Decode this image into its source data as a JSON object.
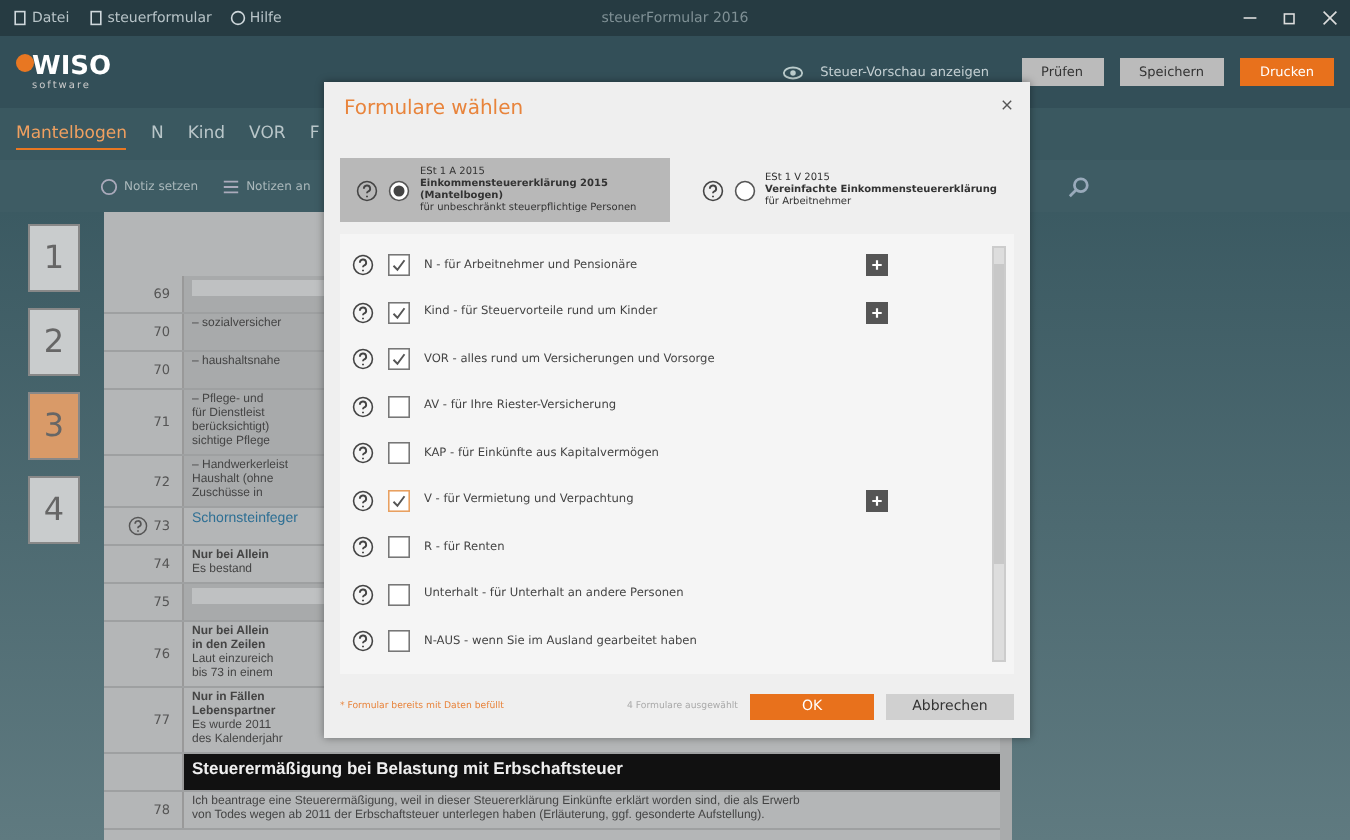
{
  "window": {
    "title": "steuerFormular 2016",
    "menu": [
      "Datei",
      "steuerformular",
      "Hilfe"
    ]
  },
  "header": {
    "logo": "WISO",
    "logo_sub": "software",
    "preview_link": "Steuer-Vorschau anzeigen",
    "buttons": [
      {
        "label": "Prüfen",
        "kind": "plain"
      },
      {
        "label": "Speichern",
        "kind": "plain"
      },
      {
        "label": "Drucken",
        "kind": "primary"
      }
    ]
  },
  "tabs": [
    {
      "label": "Mantelbogen",
      "selected": true
    },
    {
      "label": "N",
      "selected": false
    },
    {
      "label": "Kind",
      "selected": false
    },
    {
      "label": "VOR",
      "selected": false
    },
    {
      "label": "F",
      "selected": false
    }
  ],
  "toolbar": [
    "Notiz setzen",
    "Notizen an"
  ],
  "pages": [
    {
      "label": "1",
      "selected": false
    },
    {
      "label": "2",
      "selected": false
    },
    {
      "label": "3",
      "selected": true
    },
    {
      "label": "4",
      "selected": false
    }
  ],
  "document": {
    "rows": [
      {
        "number": "69",
        "text": "",
        "kind": "field"
      },
      {
        "number": "70",
        "text": "– sozialversicher",
        "kind": "field"
      },
      {
        "number": "70",
        "text": "– haushaltsnahe",
        "kind": "field"
      },
      {
        "number": "71",
        "text": "– Pflege- und\nfür Dienstleist\nberücksichtigt)\nsichtige Pflege",
        "kind": "field"
      },
      {
        "number": "72",
        "text": "– Handwerkerleist\nHaushalt (ohne\nZuschüsse in",
        "kind": "field"
      },
      {
        "number": "73",
        "text": "Schornsteinfeger",
        "kind": "link"
      },
      {
        "number": "74",
        "text": "**Nur bei Allein**\nEs bestand",
        "kind": "block"
      },
      {
        "number": "75",
        "text": "",
        "kind": "field"
      },
      {
        "number": "76",
        "text": "**Nur bei Allein**\n**in den Zeilen**\nLaut einzureich\nbis 73 in einem",
        "kind": "block"
      },
      {
        "number": "77",
        "text": "**Nur in Fällen**\n**Lebenspartner**\nEs wurde 2011\ndes Kalenderjahr",
        "kind": "block"
      },
      {
        "number": "",
        "text": "Steuerermäßigung bei Belastung mit Erbschaftsteuer",
        "kind": "heading"
      },
      {
        "number": "78",
        "text": "Ich beantrage eine Steuerermäßigung, weil in dieser Steuererklärung Einkünfte erklärt worden sind, die als Erwerb\nvon Todes wegen ab 2011 der Erbschaftsteuer unterlegen haben (Erläuterung, ggf. gesonderte Aufstellung).",
        "kind": "block"
      }
    ]
  },
  "dialog": {
    "title": "Formulare wählen",
    "options": [
      {
        "code": "ESt 1 A 2015",
        "title": "Einkommensteuererklärung 2015 (Mantelbogen)",
        "subtitle": "für unbeschränkt steuerpflichtige Personen",
        "selected": true
      },
      {
        "code": "ESt 1 V 2015",
        "title": "Vereinfachte Einkommensteuererklärung",
        "subtitle": "für Arbeitnehmer",
        "selected": false
      }
    ],
    "forms": [
      {
        "label": "N - für Arbeitnehmer und Pensionäre",
        "checked": true,
        "has_data": false,
        "addable": true
      },
      {
        "label": "Kind - für Steuervorteile rund um Kinder",
        "checked": true,
        "has_data": false,
        "addable": true
      },
      {
        "label": "VOR - alles rund um Versicherungen und Vorsorge",
        "checked": true,
        "has_data": false,
        "addable": false
      },
      {
        "label": "AV - für Ihre Riester-Versicherung",
        "checked": false,
        "has_data": false,
        "addable": false
      },
      {
        "label": "KAP - für Einkünfte aus Kapitalvermögen",
        "checked": false,
        "has_data": false,
        "addable": false
      },
      {
        "label": "V - für Vermietung und Verpachtung",
        "checked": true,
        "has_data": true,
        "addable": true
      },
      {
        "label": "R - für Renten",
        "checked": false,
        "has_data": false,
        "addable": false
      },
      {
        "label": "Unterhalt - für Unterhalt an andere Personen",
        "checked": false,
        "has_data": false,
        "addable": false
      },
      {
        "label": "N-AUS - wenn Sie im Ausland gearbeitet haben",
        "checked": false,
        "has_data": false,
        "addable": false
      }
    ],
    "footnote": "* Formular bereits mit Daten befüllt",
    "count": "4 Formulare ausgewählt",
    "ok": "OK",
    "cancel": "Abbrechen"
  }
}
